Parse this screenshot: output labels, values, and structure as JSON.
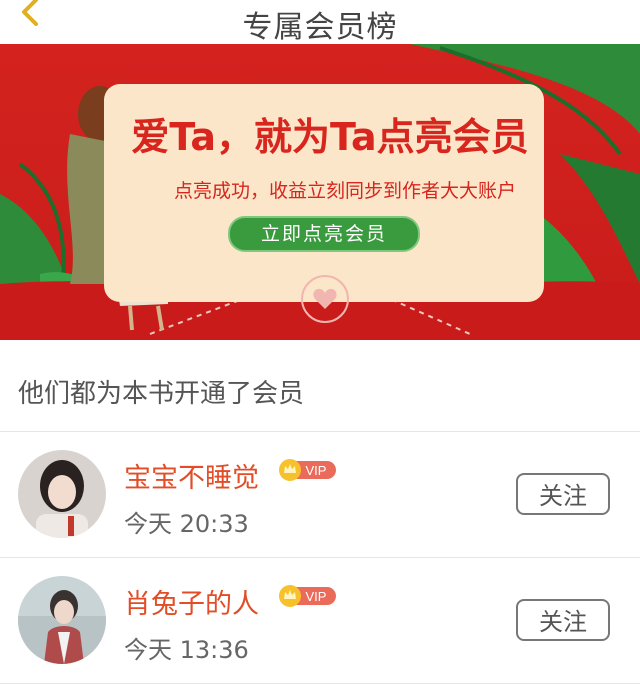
{
  "header": {
    "title": "专属会员榜"
  },
  "banner": {
    "headline": "爱Ta，就为Ta点亮会员",
    "subtitle": "点亮成功，收益立刻同步到作者大大账户",
    "cta_label": "立即点亮会员",
    "colors": {
      "background": "#cc1f1c",
      "card": "#fbe6c9",
      "accent": "#d8251e",
      "button": "#3a9a3e",
      "leaf": "#2e8b3a"
    }
  },
  "section": {
    "title": "他们都为本书开通了会员"
  },
  "members": [
    {
      "name": "宝宝不睡觉",
      "badge": "VIP",
      "time": "今天 20:33",
      "follow_label": "关注"
    },
    {
      "name": "肖兔子的人",
      "badge": "VIP",
      "time": "今天 13:36",
      "follow_label": "关注"
    }
  ],
  "icons": {
    "back": "chevron-left-icon",
    "crown": "crown-icon",
    "seal": "heart-seal-icon"
  }
}
